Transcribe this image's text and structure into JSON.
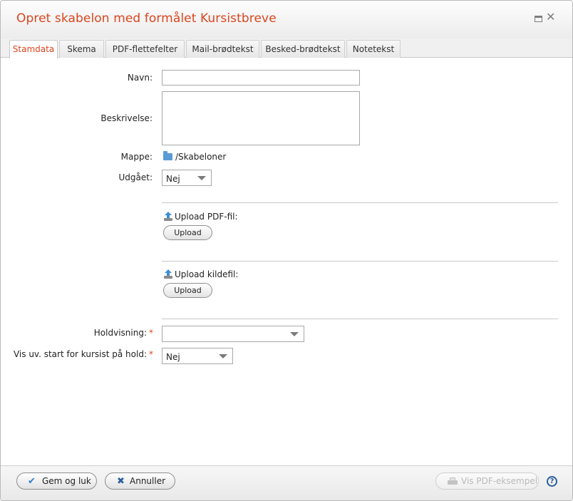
{
  "dialog": {
    "title": "Opret skabelon med formålet Kursistbreve"
  },
  "tabs": [
    {
      "label": "Stamdata",
      "active": true
    },
    {
      "label": "Skema",
      "active": false
    },
    {
      "label": "PDF-flettefelter",
      "active": false
    },
    {
      "label": "Mail-brødtekst",
      "active": false
    },
    {
      "label": "Besked-brødtekst",
      "active": false
    },
    {
      "label": "Notetekst",
      "active": false
    }
  ],
  "form": {
    "navn": {
      "label": "Navn:",
      "value": ""
    },
    "beskrivelse": {
      "label": "Beskrivelse:",
      "value": ""
    },
    "mappe": {
      "label": "Mappe:",
      "value": "/Skabeloner"
    },
    "udgaaet": {
      "label": "Udgået:",
      "value": "Nej"
    },
    "upload_pdf": {
      "label": "Upload PDF-fil:",
      "button": "Upload"
    },
    "upload_kilde": {
      "label": "Upload kildefil:",
      "button": "Upload"
    },
    "holdvisning": {
      "label": "Holdvisning:",
      "required": "*",
      "value": ""
    },
    "vis_uv_start": {
      "label": "Vis uv. start for kursist på hold:",
      "required": "*",
      "value": "Nej"
    }
  },
  "footer": {
    "save_close": "Gem og luk",
    "cancel": "Annuller",
    "pdf_preview": "Vis PDF-eksempel",
    "help": "?"
  },
  "icons": {
    "save_close": "check-icon",
    "cancel": "x-icon",
    "pdf_preview": "printer-icon",
    "help": "help-icon",
    "mappe": "folder-icon",
    "upload": "upload-icon"
  },
  "colors": {
    "accent": "#d9461e",
    "check": "#2b7fd0",
    "cancel_x": "#2b5f9e"
  }
}
